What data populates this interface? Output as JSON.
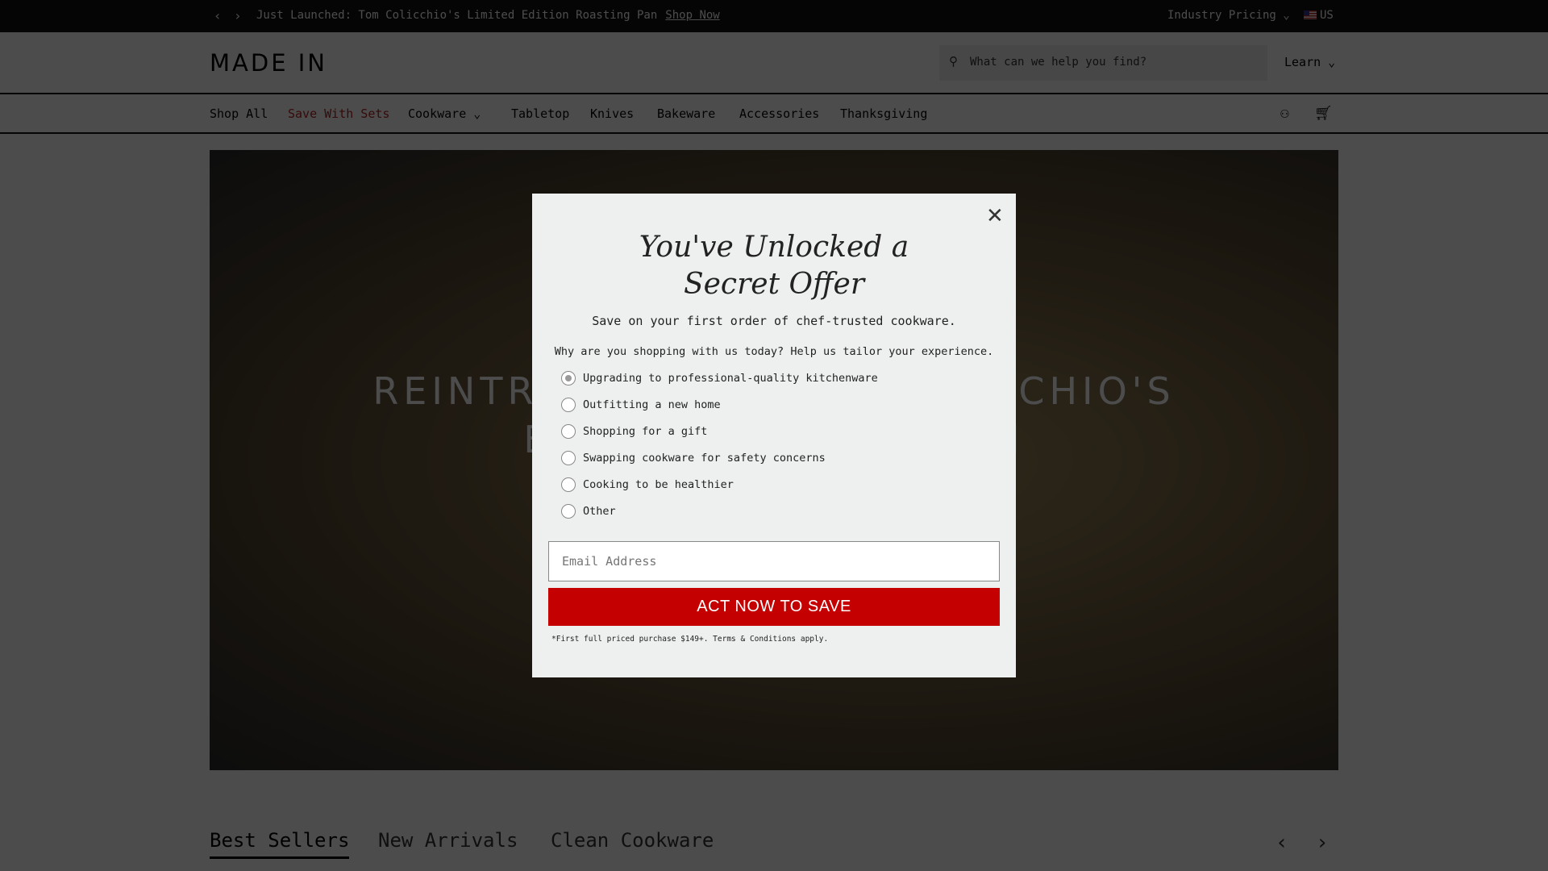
{
  "topbar": {
    "message": "Just Launched: Tom Colicchio's Limited Edition Roasting Pan",
    "link": "Shop Now",
    "industry_pricing": "Industry Pricing ⌄",
    "region": "US"
  },
  "header": {
    "logo": "MADE IN",
    "search_placeholder": "What can we help you find?",
    "learn": "Learn ⌄"
  },
  "nav": {
    "items": [
      "Shop All",
      "Save With Sets",
      "Cookware ⌄",
      "Tabletop",
      "Knives",
      "Bakeware",
      "Accessories",
      "Thanksgiving"
    ],
    "accent": "#b22222"
  },
  "hero": {
    "line1": "REINTRODUCING TOM COLICCHIO'S",
    "line2": "EVERYDAY ROAST PAN"
  },
  "tabs": [
    "Best Sellers",
    "New Arrivals",
    "Clean Cookware"
  ],
  "modal": {
    "title_line1": "You've Unlocked a",
    "title_line2": "Secret Offer",
    "subtitle": "Save on your first order of chef-trusted cookware.",
    "question": "Why are you shopping with us today? Help us tailor your experience.",
    "options": [
      "Upgrading to professional-quality kitchenware",
      "Outfitting a new home",
      "Shopping for a gift",
      "Swapping cookware for safety concerns",
      "Cooking to be healthier",
      "Other"
    ],
    "selected_option": "Upgrading to professional-quality kitchenware",
    "email_placeholder": "Email Address",
    "cta": "ACT NOW TO SAVE",
    "cta_color": "#c40000",
    "fine_print": "*First full priced purchase $149+. Terms & Conditions apply."
  }
}
